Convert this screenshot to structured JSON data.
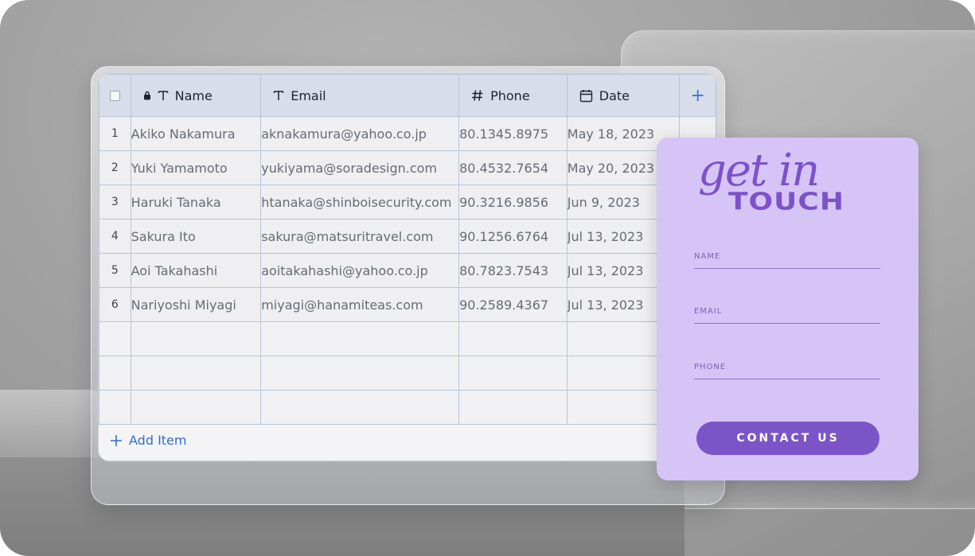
{
  "table": {
    "columns": [
      {
        "key": "name",
        "label": "Name",
        "icon": "text-type-icon",
        "locked": true
      },
      {
        "key": "email",
        "label": "Email",
        "icon": "text-type-icon"
      },
      {
        "key": "phone",
        "label": "Phone",
        "icon": "hash-icon"
      },
      {
        "key": "date",
        "label": "Date",
        "icon": "calendar-icon"
      }
    ],
    "rows": [
      {
        "n": "1",
        "name": "Akiko Nakamura",
        "email": "aknakamura@yahoo.co.jp",
        "phone": "80.1345.8975",
        "date": "May 18, 2023"
      },
      {
        "n": "2",
        "name": "Yuki Yamamoto",
        "email": "yukiyama@soradesign.com",
        "phone": "80.4532.7654",
        "date": "May 20, 2023"
      },
      {
        "n": "3",
        "name": "Haruki Tanaka",
        "email": "htanaka@shinboisecurity.com",
        "phone": "90.3216.9856",
        "date": "Jun 9, 2023"
      },
      {
        "n": "4",
        "name": "Sakura Ito",
        "email": "sakura@matsuritravel.com",
        "phone": "90.1256.6764",
        "date": "Jul 13, 2023"
      },
      {
        "n": "5",
        "name": "Aoi Takahashi",
        "email": "aoitakahashi@yahoo.co.jp",
        "phone": "80.7823.7543",
        "date": "Jul 13, 2023"
      },
      {
        "n": "6",
        "name": "Nariyoshi Miyagi",
        "email": "miyagi@hanamiteas.com",
        "phone": "90.2589.4367",
        "date": "Jul 13, 2023"
      }
    ],
    "add_item_label": "Add Item",
    "add_column_glyph": "+"
  },
  "form": {
    "title_script": "get in",
    "title_bold": "TOUCH",
    "fields": [
      "NAME",
      "EMAIL",
      "PHONE"
    ],
    "button_label": "CONTACT US",
    "accent": "#7b55c8",
    "background": "#d7c4f7"
  }
}
